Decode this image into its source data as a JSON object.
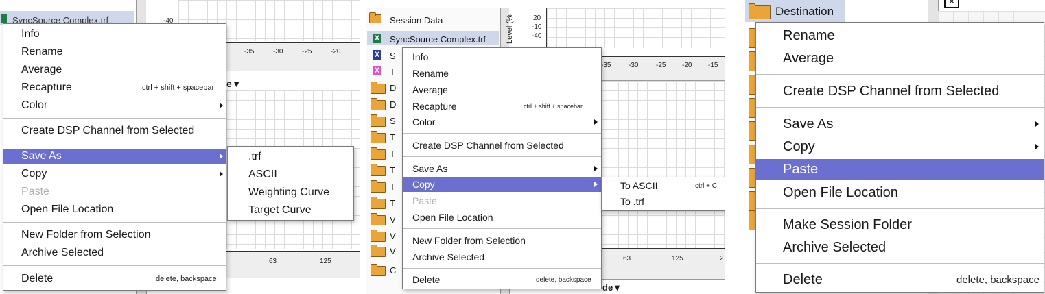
{
  "panel1": {
    "tree_item": "SyncSource Complex.trf",
    "level_ticks": [
      "-40"
    ],
    "axis_ticks": [
      "-35",
      "-30",
      "-25",
      "-20"
    ],
    "freq_ticks": [
      "63",
      "125"
    ],
    "header_fragment": "e▼",
    "menu": {
      "info": "Info",
      "rename": "Rename",
      "average": "Average",
      "recapture": "Recapture",
      "recapture_shortcut": "ctrl + shift + spacebar",
      "color": "Color",
      "create_dsp": "Create DSP Channel from Selected",
      "save_as": "Save As",
      "copy": "Copy",
      "paste": "Paste",
      "open_file_location": "Open File Location",
      "new_folder": "New Folder from Selection",
      "archive": "Archive Selected",
      "delete": "Delete",
      "delete_shortcut": "delete, backspace"
    },
    "submenu": {
      "trf": ".trf",
      "ascii": "ASCII",
      "weighting": "Weighting Curve",
      "target": "Target Curve"
    }
  },
  "panel2": {
    "tree_session": "Session Data",
    "tree_item": "SyncSource Complex.trf",
    "level_label": "Level (%",
    "level_ticks": [
      "20",
      "-10",
      "-40"
    ],
    "axis_ticks": [
      "-35",
      "-30",
      "-25",
      "-20",
      "-15"
    ],
    "freq_ticks": [
      "63",
      "125",
      "2"
    ],
    "footer_fragment": "de▼",
    "tree_letters": [
      "S",
      "T",
      "D",
      "D",
      "S",
      "T",
      "T",
      "T",
      "T",
      "T",
      "V",
      "V",
      "V",
      "C"
    ],
    "menu": {
      "info": "Info",
      "rename": "Rename",
      "average": "Average",
      "recapture": "Recapture",
      "recapture_shortcut": "ctrl + shift + spacebar",
      "color": "Color",
      "create_dsp": "Create DSP Channel from Selected",
      "save_as": "Save As",
      "copy": "Copy",
      "paste": "Paste",
      "open_file_location": "Open File Location",
      "new_folder": "New Folder from Selection",
      "archive": "Archive Selected",
      "delete": "Delete",
      "delete_shortcut": "delete, backspace"
    },
    "submenu": {
      "to_ascii": "To ASCII",
      "to_ascii_shortcut": "ctrl + C",
      "to_trf": "To .trf"
    }
  },
  "panel3": {
    "tree_item": "Destination",
    "menu": {
      "rename": "Rename",
      "average": "Average",
      "create_dsp": "Create DSP Channel from Selected",
      "save_as": "Save As",
      "copy": "Copy",
      "paste": "Paste",
      "open_file_location": "Open File Location",
      "make_session_folder": "Make Session Folder",
      "archive": "Archive Selected",
      "delete": "Delete",
      "delete_shortcut": "delete, backspace"
    }
  },
  "colors": {
    "highlight": "#6b6fcf",
    "folder": "#e9a43a",
    "file_green": "#1f7a4a",
    "file_blue": "#2b3f9a",
    "file_magenta": "#e04fd0",
    "selected_item_bg": "#cfd8ea"
  },
  "icons": [
    "folder-icon",
    "x-file-icon",
    "chevron-right-icon",
    "triangle-down-icon"
  ]
}
